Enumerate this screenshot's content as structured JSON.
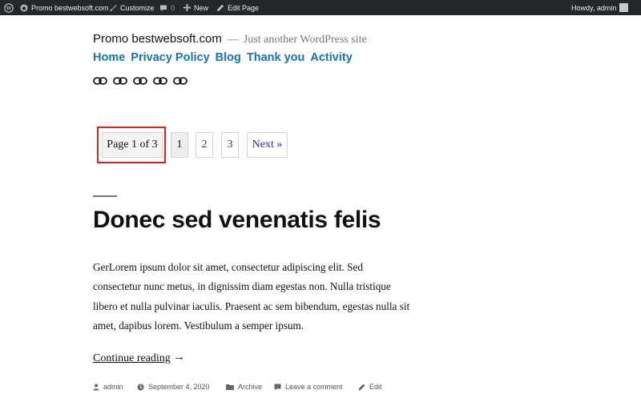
{
  "admin_bar": {
    "site_name": "Promo bestwebsoft.com",
    "customize": "Customize",
    "comments_count": "0",
    "new_label": "New",
    "edit_page": "Edit Page",
    "greeting": "Howdy, admin"
  },
  "header": {
    "site_title": "Promo bestwebsoft.com",
    "separator": "—",
    "tagline": "Just another WordPress site"
  },
  "nav": {
    "items": [
      "Home",
      "Privacy Policy",
      "Blog",
      "Thank you",
      "Activity"
    ]
  },
  "social": {
    "icons": [
      "link-icon",
      "link-icon",
      "link-icon",
      "link-icon",
      "link-icon"
    ]
  },
  "pagination": {
    "info": "Page 1 of 3",
    "current": "1",
    "page2": "2",
    "page3": "3",
    "next": "Next »"
  },
  "post": {
    "title": "Donec sed venenatis felis",
    "excerpt": "GerLorem ipsum dolor sit amet, consectetur adipiscing elit. Sed consectetur nunc metus, in dignissim diam egestas non. Nulla tristique libero et nulla pulvinar iaculis. Praesent ac sem bibendum, egestas nulla sit amet, dapibus lorem. Vestibulum a semper ipsum.",
    "continue_reading": "Continue reading",
    "continue_arrow": "→",
    "meta": {
      "author": "admin",
      "date": "September 4, 2020",
      "category": "Archive",
      "comment_link": "Leave a comment",
      "edit": "Edit"
    }
  },
  "colors": {
    "admin_bar_bg": "#23282d",
    "nav_link": "#1474b0",
    "pagination_link": "#2b2bb0",
    "highlight": "#e0201c"
  }
}
